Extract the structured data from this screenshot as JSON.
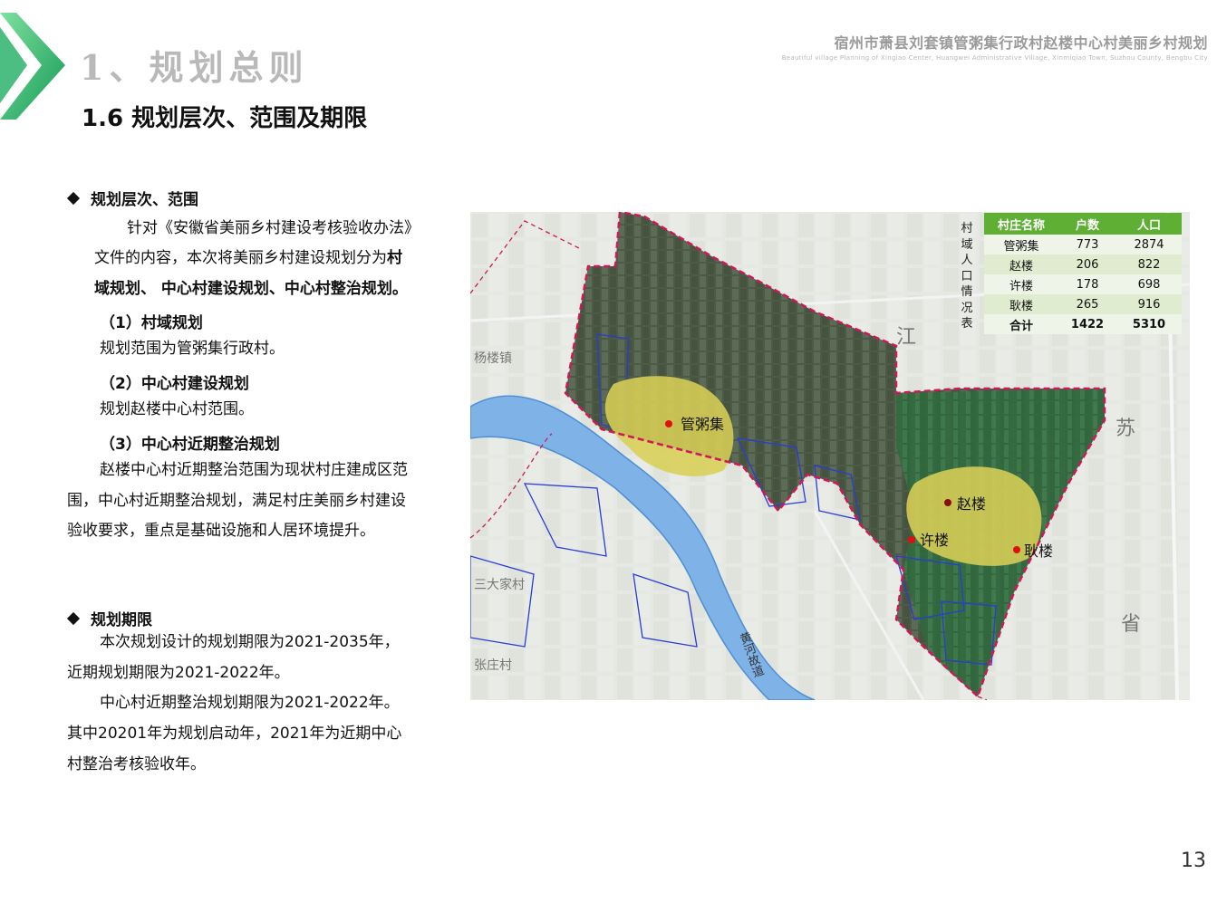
{
  "header": {
    "section_title": "1、规划总则",
    "sub_title": "1.6 规划层次、范围及期限",
    "project_title": "宿州市萧县刘套镇管粥集行政村赵楼中心村美丽乡村规划",
    "project_title_en": "Beautiful village Planning of Xingiao Center, Huangwei Administrative Village, Xinmiqiao Town, Suzhou County, Bengbu City"
  },
  "section1": {
    "heading": "规划层次、范围",
    "para1_a": "针对《安徽省美丽乡村建设考核验收办法》",
    "para1_b": "文件的内容，本次将美丽乡村建设规划分为",
    "para1_bold1": "村",
    "para1_bold2": "域规划、 中心村建设规划、中心村整治规划。",
    "sub1_title": "（1）村域规划",
    "sub1_text": "规划范围为管粥集行政村。",
    "sub2_title": "（2）中心村建设规划",
    "sub2_text": "规划赵楼中心村范围。",
    "sub3_title": "（3）中心村近期整治规划",
    "sub3_l1": "赵楼中心村近期整治范围为现状村庄建成区范",
    "sub3_l2": "围，中心村近期整治规划，满足村庄美丽乡村建设",
    "sub3_l3": "验收要求，重点是基础设施和人居环境提升。"
  },
  "section2": {
    "heading": "规划期限",
    "l1": "本次规划设计的规划期限为2021-2035年，",
    "l2": "近期规划期限为2021-2022年。",
    "l3": "中心村近期整治规划期限为2021-2022年。",
    "l4": "其中20201年为规划启动年，2021年为近期中心",
    "l5": "村整治考核验收年。"
  },
  "map": {
    "table_caption": "村域人口情况表",
    "table_headers": [
      "村庄名称",
      "户数",
      "人口"
    ],
    "table_rows": [
      [
        "管粥集",
        "773",
        "2874"
      ],
      [
        "赵楼",
        "206",
        "822"
      ],
      [
        "许楼",
        "178",
        "698"
      ],
      [
        "耿楼",
        "265",
        "916"
      ]
    ],
    "table_total": [
      "合计",
      "1422",
      "5310"
    ],
    "labels": {
      "guanzhouji": "管粥集",
      "zhaolou": "赵楼",
      "xulou": "许楼",
      "genglou": "耿楼",
      "yanglou": "杨楼镇",
      "sandajia": "三大家村",
      "zhangzhuang": "张庄村",
      "jiang": "江",
      "su": "苏",
      "sheng": "省",
      "river": "黄河故道"
    },
    "colors": {
      "boundary": "#d0175a",
      "settlement": "#d8cf57",
      "river": "#7fb2e6",
      "plots": "#2a3bd8",
      "marker": "#e01010",
      "header_green": "#5faf35"
    }
  },
  "page_number": "13"
}
